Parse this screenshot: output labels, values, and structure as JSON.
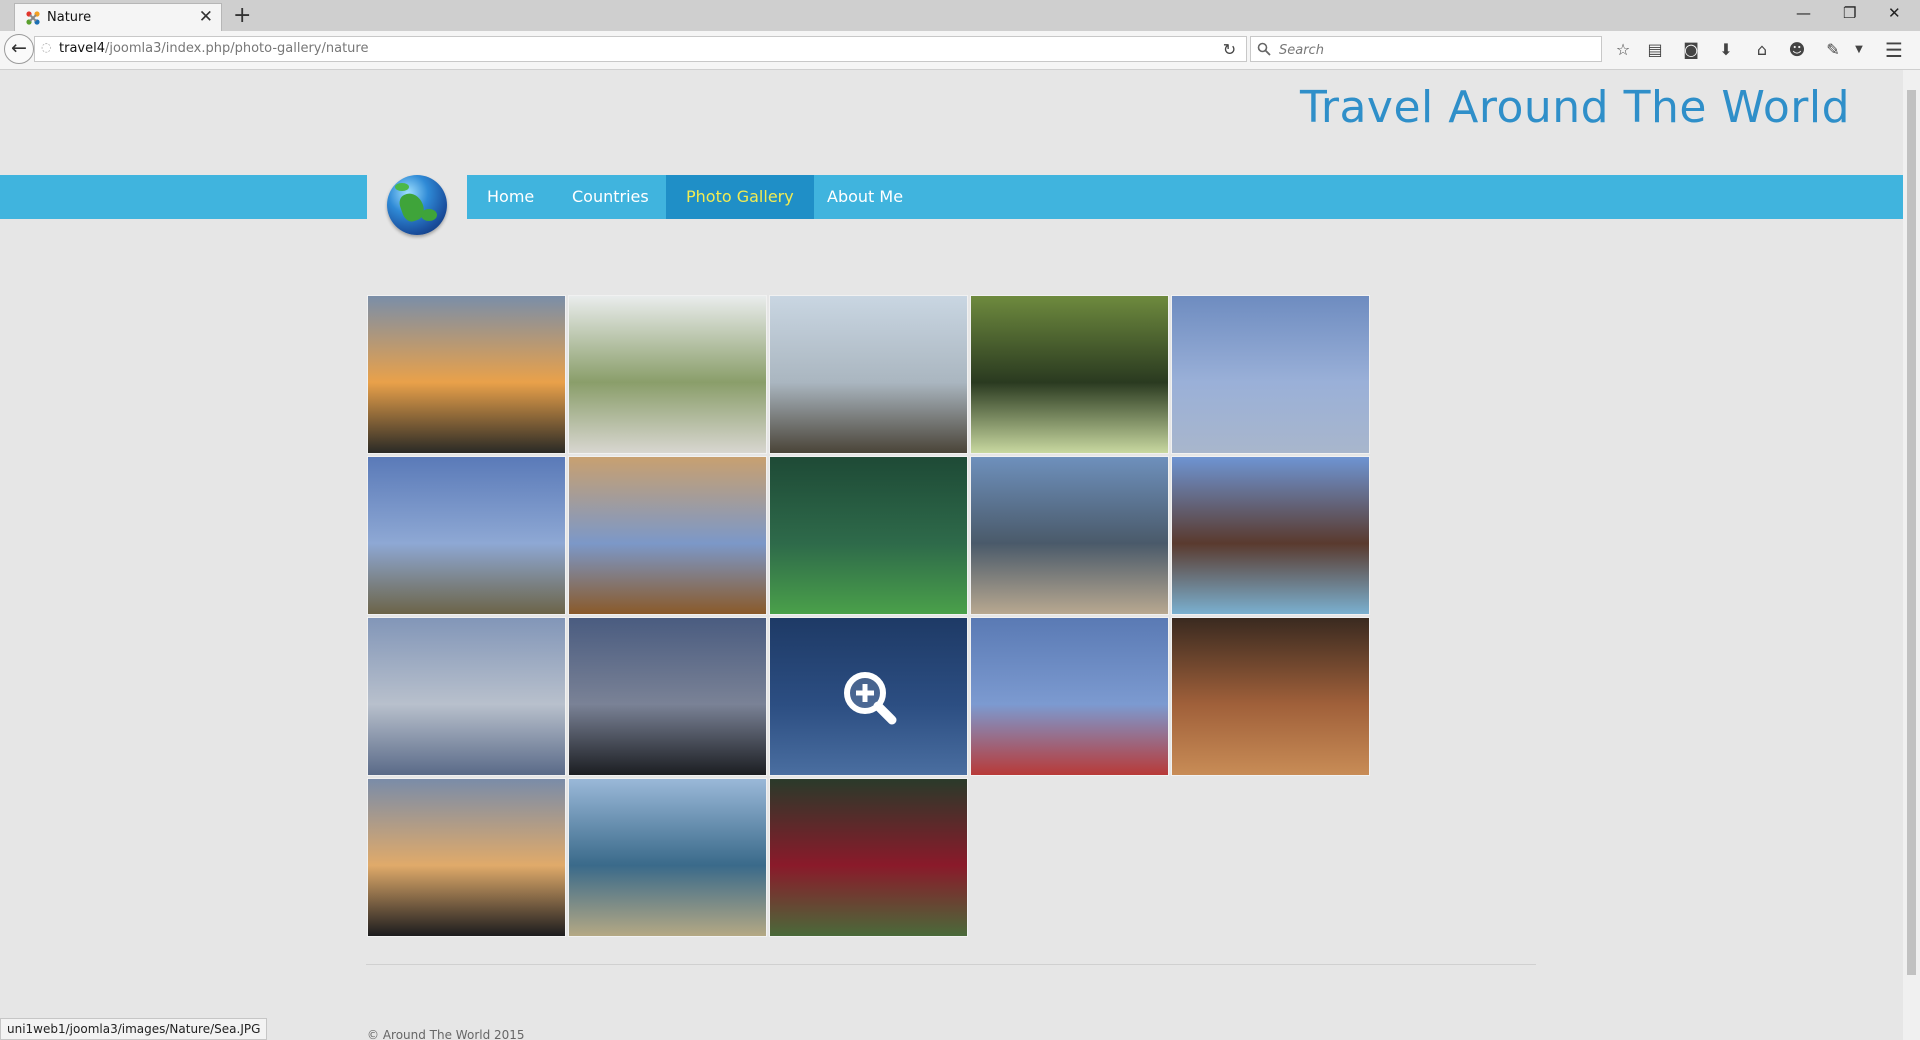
{
  "browser": {
    "tab_title": "Nature",
    "url_host": "travel4",
    "url_path": "/joomla3/index.php/photo-gallery/nature",
    "search_placeholder": "Search",
    "status_url": "uni1web1/joomla3/images/Nature/Sea.JPG"
  },
  "site": {
    "title": "Travel Around The World",
    "footer": "© Around The World 2015"
  },
  "menu": [
    {
      "label": "Home",
      "active": false
    },
    {
      "label": "Countries",
      "active": false
    },
    {
      "label": "Photo Gallery",
      "active": true
    },
    {
      "label": "About Me",
      "active": false
    }
  ],
  "colors": {
    "menu_bar": "#40b4de",
    "menu_active": "#1f8fc7",
    "menu_active_text": "#f2ec52",
    "title": "#2f8fc9"
  },
  "gallery": {
    "images": [
      {
        "subject": "sunset over sea",
        "colors": [
          "#7a8ea8",
          "#e9a14a",
          "#2a2a26"
        ]
      },
      {
        "subject": "bird on rock",
        "colors": [
          "#e9ecec",
          "#8a9e6a",
          "#d8d6d0"
        ]
      },
      {
        "subject": "rocky coast",
        "colors": [
          "#c9d6e2",
          "#aab6c0",
          "#4a4438"
        ]
      },
      {
        "subject": "cat in palm leaves",
        "colors": [
          "#6e8a3e",
          "#2a3a20",
          "#c8d8a0"
        ]
      },
      {
        "subject": "blue sky contrail",
        "colors": [
          "#6e8cc0",
          "#9ab0d8",
          "#a8b6cc"
        ]
      },
      {
        "subject": "sky over beach",
        "colors": [
          "#5a7ab8",
          "#8ea8d4",
          "#6c6448"
        ]
      },
      {
        "subject": "blue coral",
        "colors": [
          "#c8a070",
          "#7c98c8",
          "#8a5a2a"
        ]
      },
      {
        "subject": "green park trees",
        "colors": [
          "#1e4a36",
          "#2e6a4a",
          "#4aa04a"
        ]
      },
      {
        "subject": "rocks on sandy beach",
        "colors": [
          "#6e90bc",
          "#4a5a6a",
          "#b8a890"
        ]
      },
      {
        "subject": "pirate ship at pier",
        "colors": [
          "#6e94d2",
          "#5a3a2e",
          "#7ab0d0"
        ]
      },
      {
        "subject": "cloudy sky",
        "colors": [
          "#8296b8",
          "#b8c0cc",
          "#5a6a88"
        ]
      },
      {
        "subject": "sea at dusk",
        "colors": [
          "#4a5c80",
          "#7a8296",
          "#1c1e22"
        ]
      },
      {
        "subject": "boat wake on sea",
        "colors": [
          "#1e3a66",
          "#2c4e82",
          "#4a6ea0"
        ]
      },
      {
        "subject": "seagull on buoy",
        "colors": [
          "#5a7ab4",
          "#7c9ad0",
          "#b83a38"
        ]
      },
      {
        "subject": "seashell display",
        "colors": [
          "#3a2a20",
          "#a0603a",
          "#c88c56"
        ]
      },
      {
        "subject": "sunset silhouettes",
        "colors": [
          "#7a8ca8",
          "#e0aa6a",
          "#1c1c1e"
        ]
      },
      {
        "subject": "surf on beach",
        "colors": [
          "#9ab8d8",
          "#3a6a8a",
          "#b4a884"
        ]
      },
      {
        "subject": "red flowering bush",
        "colors": [
          "#2a3a2a",
          "#8a1a2a",
          "#4a6a3a"
        ]
      }
    ]
  }
}
